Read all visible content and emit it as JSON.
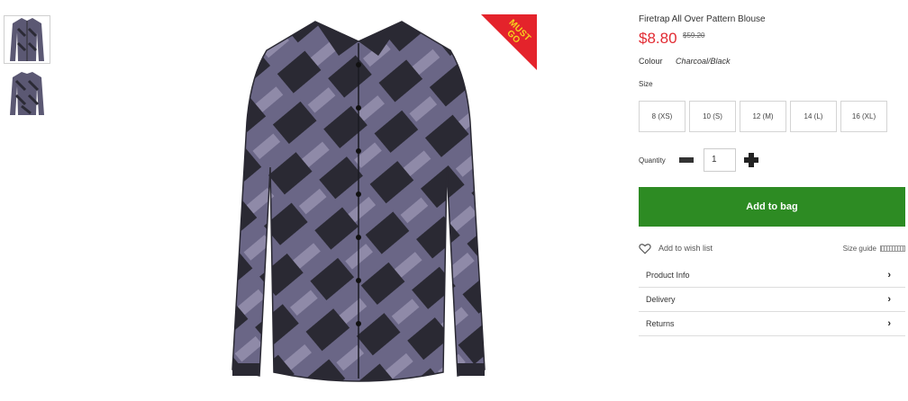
{
  "thumbnails": [
    {
      "name": "front-view",
      "active": true
    },
    {
      "name": "back-view",
      "active": false
    }
  ],
  "badge": {
    "line1": "MUST",
    "line2": "GO",
    "color": "#e4232b",
    "text_color": "#f6d21f"
  },
  "product": {
    "title": "Firetrap All Over Pattern Blouse",
    "price": "$8.80",
    "was_price": "$59.20",
    "colour_label": "Colour",
    "colour_value": "Charcoal/Black",
    "size_label": "Size",
    "sizes": [
      "8 (XS)",
      "10 (S)",
      "12 (M)",
      "14 (L)",
      "16 (XL)"
    ],
    "quantity_label": "Quantity",
    "quantity_value": "1"
  },
  "actions": {
    "add_to_bag": "Add to bag",
    "wish_list": "Add to wish list",
    "size_guide": "Size guide"
  },
  "accordion": [
    "Product Info",
    "Delivery",
    "Returns"
  ],
  "colors": {
    "price": "#e22a32",
    "add_to_bag": "#2d8b23",
    "shirt": "#5e5a78"
  }
}
